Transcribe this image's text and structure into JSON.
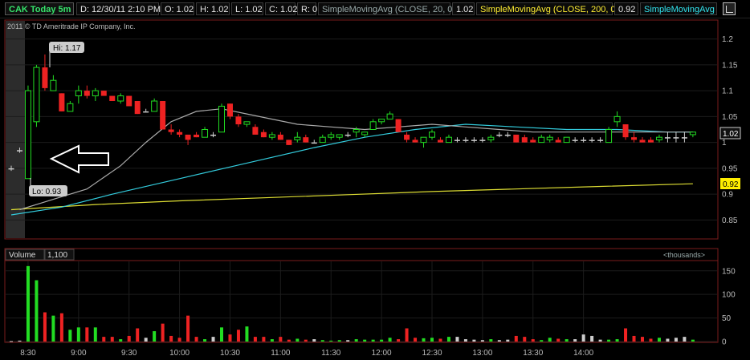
{
  "header": {
    "symbol": "CAK Today 5m",
    "date": "D: 12/30/11 2:10 PM",
    "open": "O: 1.02",
    "high": "H: 1.02",
    "low": "L: 1.02",
    "close": "C: 1.02",
    "range": "R: 0",
    "sma20_label": "SimpleMovingAvg (CLOSE, 20, 0)",
    "sma20_value": "1.02",
    "sma200_label": "SimpleMovingAvg (CLOSE, 200, 0)",
    "sma200_value": "0.92",
    "sma_cut_label": "SimpleMovingAvg (..."
  },
  "copyright": "2011 © TD Ameritrade IP Company, Inc.",
  "annotations": {
    "hi": "Hi: 1.17",
    "lo": "Lo: 0.93"
  },
  "volume_panel": {
    "title": "Volume",
    "value": "1,100",
    "units": "<thousands>"
  },
  "colors": {
    "up": "#22dd22",
    "down": "#ee2222",
    "neutral": "#cccccc",
    "sma20": "#aaaaaa",
    "sma50": "#33ccdd",
    "sma200": "#dddd33",
    "axis": "#7a1b1b"
  },
  "chart_data": {
    "type": "candlestick",
    "price_axis": {
      "ticks": [
        0.85,
        0.9,
        0.95,
        1,
        1.05,
        1.1,
        1.15,
        1.2
      ],
      "tick_labels": [
        "0.85",
        "0.9",
        "0.95",
        "1",
        "1.05",
        "1.1",
        "1.15",
        "1.2"
      ],
      "ylim": [
        0.815,
        1.235
      ]
    },
    "last_price_label": "1.02",
    "sma200_price_label": "0.92",
    "time_labels": [
      "8:30",
      "9:00",
      "9:30",
      "10:00",
      "10:30",
      "11:00",
      "11:30",
      "12:00",
      "12:30",
      "13:00",
      "13:30",
      "14:00"
    ],
    "volume_axis": {
      "ticks": [
        0,
        50,
        100,
        150
      ],
      "tick_labels": [
        "0",
        "50",
        "100",
        "150"
      ],
      "ylim": [
        0,
        170
      ]
    },
    "candles": [
      {
        "o": 0.95,
        "h": 0.955,
        "l": 0.945,
        "c": 0.95,
        "v": 1
      },
      {
        "o": 0.985,
        "h": 0.99,
        "l": 0.98,
        "c": 0.985,
        "v": 2
      },
      {
        "o": 0.93,
        "h": 1.11,
        "l": 0.93,
        "c": 1.1,
        "v": 160
      },
      {
        "o": 1.04,
        "h": 1.15,
        "l": 1.03,
        "c": 1.145,
        "v": 130
      },
      {
        "o": 1.145,
        "h": 1.17,
        "l": 1.1,
        "c": 1.105,
        "v": 62
      },
      {
        "o": 1.1,
        "h": 1.13,
        "l": 1.1,
        "c": 1.12,
        "v": 55
      },
      {
        "o": 1.095,
        "h": 1.095,
        "l": 1.06,
        "c": 1.06,
        "v": 60
      },
      {
        "o": 1.06,
        "h": 1.08,
        "l": 1.06,
        "c": 1.075,
        "v": 25
      },
      {
        "o": 1.09,
        "h": 1.11,
        "l": 1.075,
        "c": 1.1,
        "v": 30
      },
      {
        "o": 1.1,
        "h": 1.11,
        "l": 1.085,
        "c": 1.09,
        "v": 30
      },
      {
        "o": 1.09,
        "h": 1.105,
        "l": 1.08,
        "c": 1.1,
        "v": 30
      },
      {
        "o": 1.1,
        "h": 1.1,
        "l": 1.09,
        "c": 1.09,
        "v": 10
      },
      {
        "o": 1.09,
        "h": 1.09,
        "l": 1.08,
        "c": 1.08,
        "v": 10
      },
      {
        "o": 1.08,
        "h": 1.095,
        "l": 1.075,
        "c": 1.09,
        "v": 5
      },
      {
        "o": 1.09,
        "h": 1.09,
        "l": 1.07,
        "c": 1.07,
        "v": 12
      },
      {
        "o": 1.08,
        "h": 1.08,
        "l": 1.055,
        "c": 1.055,
        "v": 28
      },
      {
        "o": 1.06,
        "h": 1.065,
        "l": 1.06,
        "c": 1.06,
        "v": 8
      },
      {
        "o": 1.06,
        "h": 1.085,
        "l": 1.06,
        "c": 1.08,
        "v": 22
      },
      {
        "o": 1.08,
        "h": 1.08,
        "l": 1.025,
        "c": 1.025,
        "v": 38
      },
      {
        "o": 1.025,
        "h": 1.035,
        "l": 1.015,
        "c": 1.02,
        "v": 12
      },
      {
        "o": 1.02,
        "h": 1.025,
        "l": 1.01,
        "c": 1.015,
        "v": 8
      },
      {
        "o": 1.015,
        "h": 1.015,
        "l": 0.995,
        "c": 1.005,
        "v": 55
      },
      {
        "o": 1.015,
        "h": 1.02,
        "l": 1.01,
        "c": 1.01,
        "v": 10
      },
      {
        "o": 1.01,
        "h": 1.03,
        "l": 1.01,
        "c": 1.025,
        "v": 5
      },
      {
        "o": 1.015,
        "h": 1.02,
        "l": 1.01,
        "c": 1.015,
        "v": 10
      },
      {
        "o": 1.02,
        "h": 1.075,
        "l": 1.02,
        "c": 1.07,
        "v": 30
      },
      {
        "o": 1.075,
        "h": 1.075,
        "l": 1.045,
        "c": 1.05,
        "v": 15
      },
      {
        "o": 1.05,
        "h": 1.055,
        "l": 1.03,
        "c": 1.035,
        "v": 25
      },
      {
        "o": 1.035,
        "h": 1.04,
        "l": 1.03,
        "c": 1.04,
        "v": 32
      },
      {
        "o": 1.03,
        "h": 1.035,
        "l": 1.015,
        "c": 1.015,
        "v": 10
      },
      {
        "o": 1.02,
        "h": 1.025,
        "l": 1.01,
        "c": 1.01,
        "v": 10
      },
      {
        "o": 1.01,
        "h": 1.02,
        "l": 1.005,
        "c": 1.015,
        "v": 5
      },
      {
        "o": 1.015,
        "h": 1.02,
        "l": 1.005,
        "c": 1.005,
        "v": 10
      },
      {
        "o": 1.005,
        "h": 1.005,
        "l": 0.995,
        "c": 0.995,
        "v": 4
      },
      {
        "o": 1.005,
        "h": 1.02,
        "l": 1.0,
        "c": 1.01,
        "v": 6
      },
      {
        "o": 1.01,
        "h": 1.015,
        "l": 1.0,
        "c": 1.0,
        "v": 4
      },
      {
        "o": 1.0,
        "h": 1.005,
        "l": 1.0,
        "c": 1.0,
        "v": 5
      },
      {
        "o": 1.0,
        "h": 1.015,
        "l": 1.0,
        "c": 1.01,
        "v": 3
      },
      {
        "o": 1.01,
        "h": 1.02,
        "l": 1.005,
        "c": 1.015,
        "v": 2
      },
      {
        "o": 1.01,
        "h": 1.015,
        "l": 1.005,
        "c": 1.015,
        "v": 3
      },
      {
        "o": 1.015,
        "h": 1.02,
        "l": 1.01,
        "c": 1.015,
        "v": 3
      },
      {
        "o": 1.02,
        "h": 1.03,
        "l": 1.01,
        "c": 1.025,
        "v": 5
      },
      {
        "o": 1.015,
        "h": 1.02,
        "l": 1.01,
        "c": 1.02,
        "v": 4
      },
      {
        "o": 1.025,
        "h": 1.045,
        "l": 1.025,
        "c": 1.04,
        "v": 4
      },
      {
        "o": 1.04,
        "h": 1.045,
        "l": 1.035,
        "c": 1.045,
        "v": 4
      },
      {
        "o": 1.045,
        "h": 1.06,
        "l": 1.045,
        "c": 1.055,
        "v": 8
      },
      {
        "o": 1.045,
        "h": 1.045,
        "l": 1.02,
        "c": 1.02,
        "v": 5
      },
      {
        "o": 1.015,
        "h": 1.02,
        "l": 1.0,
        "c": 1.005,
        "v": 28
      },
      {
        "o": 1.005,
        "h": 1.01,
        "l": 1.0,
        "c": 1.0,
        "v": 8
      },
      {
        "o": 1.0,
        "h": 1.01,
        "l": 0.99,
        "c": 1.01,
        "v": 7
      },
      {
        "o": 1.01,
        "h": 1.025,
        "l": 1.005,
        "c": 1.02,
        "v": 8
      },
      {
        "o": 1.005,
        "h": 1.01,
        "l": 1.0,
        "c": 1.0,
        "v": 6
      },
      {
        "o": 1.0,
        "h": 1.015,
        "l": 1.0,
        "c": 1.01,
        "v": 10
      },
      {
        "o": 1.005,
        "h": 1.01,
        "l": 1.0,
        "c": 1.005,
        "v": 10
      },
      {
        "o": 1.005,
        "h": 1.01,
        "l": 1.0,
        "c": 1.005,
        "v": 5
      },
      {
        "o": 1.005,
        "h": 1.01,
        "l": 1.0,
        "c": 1.005,
        "v": 4
      },
      {
        "o": 1.005,
        "h": 1.01,
        "l": 1.0,
        "c": 1.005,
        "v": 3
      },
      {
        "o": 1.005,
        "h": 1.015,
        "l": 1.0,
        "c": 1.01,
        "v": 5
      },
      {
        "o": 1.015,
        "h": 1.02,
        "l": 1.01,
        "c": 1.015,
        "v": 3
      },
      {
        "o": 1.015,
        "h": 1.02,
        "l": 1.01,
        "c": 1.015,
        "v": 4
      },
      {
        "o": 1.015,
        "h": 1.015,
        "l": 1.0,
        "c": 1.0,
        "v": 12
      },
      {
        "o": 1.01,
        "h": 1.015,
        "l": 1.0,
        "c": 1.0,
        "v": 10
      },
      {
        "o": 1.005,
        "h": 1.01,
        "l": 1.0,
        "c": 1.0,
        "v": 5
      },
      {
        "o": 1.0,
        "h": 1.015,
        "l": 1.0,
        "c": 1.01,
        "v": 3
      },
      {
        "o": 1.005,
        "h": 1.015,
        "l": 1.0,
        "c": 1.01,
        "v": 8
      },
      {
        "o": 1.005,
        "h": 1.01,
        "l": 1.0,
        "c": 1.0,
        "v": 6
      },
      {
        "o": 1.0,
        "h": 1.01,
        "l": 1.0,
        "c": 1.01,
        "v": 5
      },
      {
        "o": 1.005,
        "h": 1.01,
        "l": 1.0,
        "c": 1.005,
        "v": 5
      },
      {
        "o": 1.005,
        "h": 1.01,
        "l": 1.0,
        "c": 1.005,
        "v": 15
      },
      {
        "o": 1.005,
        "h": 1.01,
        "l": 1.0,
        "c": 1.005,
        "v": 12
      },
      {
        "o": 1.005,
        "h": 1.01,
        "l": 1.0,
        "c": 1.005,
        "v": 4
      },
      {
        "o": 1.0,
        "h": 1.03,
        "l": 1.0,
        "c": 1.025,
        "v": 4
      },
      {
        "o": 1.04,
        "h": 1.06,
        "l": 1.03,
        "c": 1.05,
        "v": 5
      },
      {
        "o": 1.035,
        "h": 1.035,
        "l": 1.005,
        "c": 1.01,
        "v": 28
      },
      {
        "o": 1.01,
        "h": 1.02,
        "l": 1.0,
        "c": 1.005,
        "v": 12
      },
      {
        "o": 1.005,
        "h": 1.01,
        "l": 1.0,
        "c": 1.0,
        "v": 10
      },
      {
        "o": 1.005,
        "h": 1.01,
        "l": 1.0,
        "c": 1.0,
        "v": 6
      },
      {
        "o": 1.005,
        "h": 1.015,
        "l": 1.0,
        "c": 1.01,
        "v": 8
      },
      {
        "o": 1.01,
        "h": 1.02,
        "l": 1.0,
        "c": 1.01,
        "v": 6
      },
      {
        "o": 1.01,
        "h": 1.02,
        "l": 1.0,
        "c": 1.01,
        "v": 8
      },
      {
        "o": 1.01,
        "h": 1.02,
        "l": 1.0,
        "c": 1.01,
        "v": 10
      },
      {
        "o": 1.015,
        "h": 1.02,
        "l": 1.01,
        "c": 1.02,
        "v": 4
      }
    ],
    "sma20": [
      [
        1,
        0.87
      ],
      [
        5,
        0.89
      ],
      [
        9,
        0.91
      ],
      [
        13,
        0.955
      ],
      [
        16,
        1.0
      ],
      [
        19,
        1.04
      ],
      [
        22,
        1.06
      ],
      [
        25,
        1.065
      ],
      [
        28,
        1.055
      ],
      [
        31,
        1.045
      ],
      [
        34,
        1.035
      ],
      [
        38,
        1.03
      ],
      [
        42,
        1.025
      ],
      [
        46,
        1.03
      ],
      [
        50,
        1.035
      ],
      [
        54,
        1.03
      ],
      [
        58,
        1.025
      ],
      [
        62,
        1.02
      ],
      [
        66,
        1.02
      ],
      [
        70,
        1.02
      ],
      [
        74,
        1.02
      ],
      [
        78,
        1.02
      ],
      [
        81,
        1.02
      ]
    ],
    "sma50": [
      [
        0,
        0.86
      ],
      [
        6,
        0.875
      ],
      [
        12,
        0.9
      ],
      [
        20,
        0.93
      ],
      [
        28,
        0.96
      ],
      [
        36,
        0.99
      ],
      [
        42,
        1.01
      ],
      [
        48,
        1.025
      ],
      [
        54,
        1.035
      ],
      [
        60,
        1.03
      ],
      [
        66,
        1.025
      ],
      [
        72,
        1.025
      ],
      [
        78,
        1.02
      ],
      [
        81,
        1.02
      ]
    ],
    "sma200": [
      [
        0,
        0.87
      ],
      [
        10,
        0.88
      ],
      [
        20,
        0.887
      ],
      [
        30,
        0.893
      ],
      [
        40,
        0.899
      ],
      [
        50,
        0.905
      ],
      [
        60,
        0.91
      ],
      [
        70,
        0.915
      ],
      [
        81,
        0.92
      ]
    ]
  }
}
